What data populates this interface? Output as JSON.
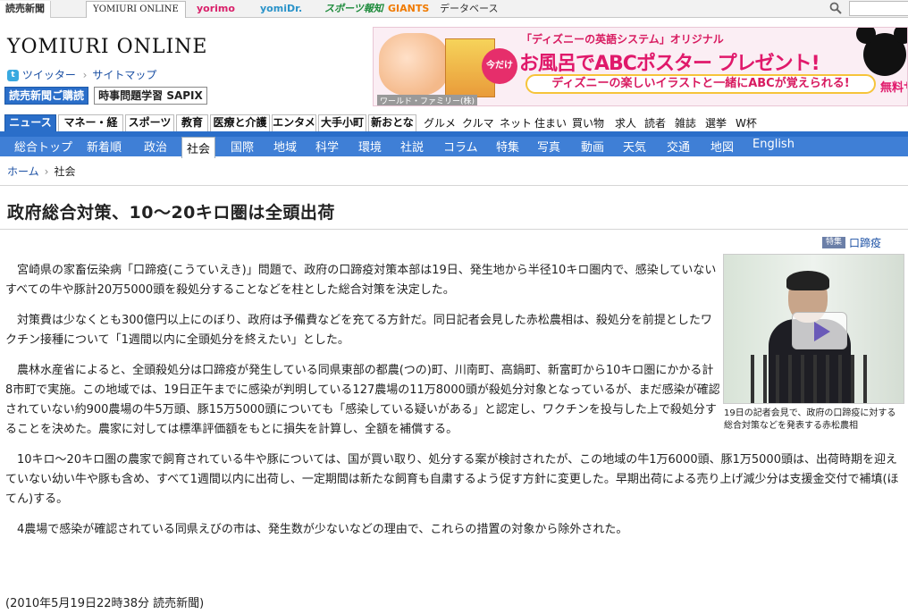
{
  "sitebar": {
    "tabs": [
      "読売新聞",
      "YOMIURI ONLINE",
      "yorimo",
      "yomiDr.",
      "スポーツ報知",
      "GIANTS",
      "データベース"
    ]
  },
  "header": {
    "logo": "YOMIURI ONLINE",
    "twitter": "ツイッター",
    "sitemap": "サイトマップ",
    "subscribe": "読売新聞ご購読",
    "sapix": "時事問題学習 SAPIX"
  },
  "banner": {
    "tagline": "「ディズニーの英語システム」オリジナル",
    "badge": "今だけ",
    "headline": "お風呂でABCポスター プレゼント!",
    "sub": "ディズニーの楽しいイラストと一緒にABCが覚えられる!",
    "free": "無料サン",
    "credit": "ワールド・ファミリー(株)"
  },
  "categories": {
    "tabs": [
      "ニュース",
      "マネー・経済",
      "スポーツ",
      "教育",
      "医療と介護",
      "エンタメ",
      "大手小町",
      "新おとな"
    ],
    "links": [
      "グルメ",
      "クルマ",
      "ネット",
      "住まい",
      "買い物",
      "求人",
      "読者",
      "雑誌",
      "選挙",
      "W杯"
    ]
  },
  "nav": [
    "総合トップ",
    "新着順",
    "政治",
    "社会",
    "国際",
    "地域",
    "科学",
    "環境",
    "社説",
    "コラム",
    "特集",
    "写真",
    "動画",
    "天気",
    "交通",
    "地図",
    "English"
  ],
  "breadcrumb": {
    "home": "ホーム",
    "current": "社会"
  },
  "article": {
    "title": "政府総合対策、10～20キロ圏は全頭出荷",
    "tag_badge": "特集",
    "tag_name": "口蹄疫",
    "paragraphs": [
      "宮崎県の家畜伝染病「口蹄疫(こうていえき)」問題で、政府の口蹄疫対策本部は19日、発生地から半径10キロ圏内で、感染していないすべての牛や豚計20万5000頭を殺処分することなどを柱とした総合対策を決定した。",
      "対策費は少なくとも300億円以上にのぼり、政府は予備費などを充てる方針だ。同日記者会見した赤松農相は、殺処分を前提としたワクチン接種について「1週間以内に全頭処分を終えたい」とした。",
      "農林水産省によると、全頭殺処分は口蹄疫が発生している同県東部の都農(つの)町、川南町、高鍋町、新富町から10キロ圏にかかる計8市町で実施。この地域では、19日正午までに感染が判明している127農場の11万8000頭が殺処分対象となっているが、まだ感染が確認されていない約900農場の牛5万頭、豚15万5000頭についても「感染している疑いがある」と認定し、ワクチンを投与した上で殺処分することを決めた。農家に対しては標準評価額をもとに損失を計算し、全額を補償する。",
      "10キロ～20キロ圏の農家で飼育されている牛や豚については、国が買い取り、処分する案が検討されたが、この地域の牛1万6000頭、豚1万5000頭は、出荷時期を迎えていない幼い牛や豚も含め、すべて1週間以内に出荷し、一定期間は新たな飼育も自粛するよう促す方針に変更した。早期出荷による売り上げ減少分は支援金交付で補填(ほてん)する。",
      "4農場で感染が確認されている同県えびの市は、発生数が少ないなどの理由で、これらの措置の対象から除外された。"
    ],
    "dateline": "(2010年5月19日22時38分  読売新聞)",
    "photo_caption": "19日の記者会見で、政府の口蹄疫に対する総合対策などを発表する赤松農相"
  }
}
